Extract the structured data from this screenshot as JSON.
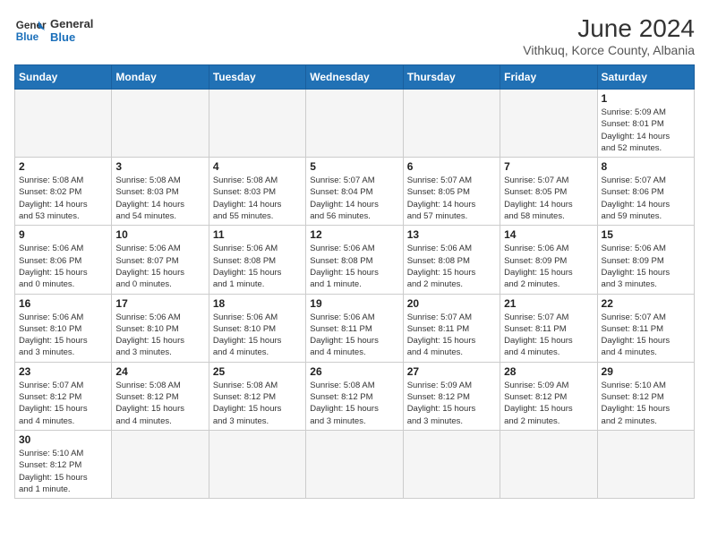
{
  "logo": {
    "general": "General",
    "blue": "Blue"
  },
  "title": "June 2024",
  "subtitle": "Vithkuq, Korce County, Albania",
  "days_of_week": [
    "Sunday",
    "Monday",
    "Tuesday",
    "Wednesday",
    "Thursday",
    "Friday",
    "Saturday"
  ],
  "weeks": [
    [
      {
        "day": "",
        "info": ""
      },
      {
        "day": "",
        "info": ""
      },
      {
        "day": "",
        "info": ""
      },
      {
        "day": "",
        "info": ""
      },
      {
        "day": "",
        "info": ""
      },
      {
        "day": "",
        "info": ""
      },
      {
        "day": "1",
        "info": "Sunrise: 5:09 AM\nSunset: 8:01 PM\nDaylight: 14 hours\nand 52 minutes."
      }
    ],
    [
      {
        "day": "2",
        "info": "Sunrise: 5:08 AM\nSunset: 8:02 PM\nDaylight: 14 hours\nand 53 minutes."
      },
      {
        "day": "3",
        "info": "Sunrise: 5:08 AM\nSunset: 8:03 PM\nDaylight: 14 hours\nand 54 minutes."
      },
      {
        "day": "4",
        "info": "Sunrise: 5:08 AM\nSunset: 8:03 PM\nDaylight: 14 hours\nand 55 minutes."
      },
      {
        "day": "5",
        "info": "Sunrise: 5:07 AM\nSunset: 8:04 PM\nDaylight: 14 hours\nand 56 minutes."
      },
      {
        "day": "6",
        "info": "Sunrise: 5:07 AM\nSunset: 8:05 PM\nDaylight: 14 hours\nand 57 minutes."
      },
      {
        "day": "7",
        "info": "Sunrise: 5:07 AM\nSunset: 8:05 PM\nDaylight: 14 hours\nand 58 minutes."
      },
      {
        "day": "8",
        "info": "Sunrise: 5:07 AM\nSunset: 8:06 PM\nDaylight: 14 hours\nand 59 minutes."
      }
    ],
    [
      {
        "day": "9",
        "info": "Sunrise: 5:06 AM\nSunset: 8:06 PM\nDaylight: 15 hours\nand 0 minutes."
      },
      {
        "day": "10",
        "info": "Sunrise: 5:06 AM\nSunset: 8:07 PM\nDaylight: 15 hours\nand 0 minutes."
      },
      {
        "day": "11",
        "info": "Sunrise: 5:06 AM\nSunset: 8:08 PM\nDaylight: 15 hours\nand 1 minute."
      },
      {
        "day": "12",
        "info": "Sunrise: 5:06 AM\nSunset: 8:08 PM\nDaylight: 15 hours\nand 1 minute."
      },
      {
        "day": "13",
        "info": "Sunrise: 5:06 AM\nSunset: 8:08 PM\nDaylight: 15 hours\nand 2 minutes."
      },
      {
        "day": "14",
        "info": "Sunrise: 5:06 AM\nSunset: 8:09 PM\nDaylight: 15 hours\nand 2 minutes."
      },
      {
        "day": "15",
        "info": "Sunrise: 5:06 AM\nSunset: 8:09 PM\nDaylight: 15 hours\nand 3 minutes."
      }
    ],
    [
      {
        "day": "16",
        "info": "Sunrise: 5:06 AM\nSunset: 8:10 PM\nDaylight: 15 hours\nand 3 minutes."
      },
      {
        "day": "17",
        "info": "Sunrise: 5:06 AM\nSunset: 8:10 PM\nDaylight: 15 hours\nand 3 minutes."
      },
      {
        "day": "18",
        "info": "Sunrise: 5:06 AM\nSunset: 8:10 PM\nDaylight: 15 hours\nand 4 minutes."
      },
      {
        "day": "19",
        "info": "Sunrise: 5:06 AM\nSunset: 8:11 PM\nDaylight: 15 hours\nand 4 minutes."
      },
      {
        "day": "20",
        "info": "Sunrise: 5:07 AM\nSunset: 8:11 PM\nDaylight: 15 hours\nand 4 minutes."
      },
      {
        "day": "21",
        "info": "Sunrise: 5:07 AM\nSunset: 8:11 PM\nDaylight: 15 hours\nand 4 minutes."
      },
      {
        "day": "22",
        "info": "Sunrise: 5:07 AM\nSunset: 8:11 PM\nDaylight: 15 hours\nand 4 minutes."
      }
    ],
    [
      {
        "day": "23",
        "info": "Sunrise: 5:07 AM\nSunset: 8:12 PM\nDaylight: 15 hours\nand 4 minutes."
      },
      {
        "day": "24",
        "info": "Sunrise: 5:08 AM\nSunset: 8:12 PM\nDaylight: 15 hours\nand 4 minutes."
      },
      {
        "day": "25",
        "info": "Sunrise: 5:08 AM\nSunset: 8:12 PM\nDaylight: 15 hours\nand 3 minutes."
      },
      {
        "day": "26",
        "info": "Sunrise: 5:08 AM\nSunset: 8:12 PM\nDaylight: 15 hours\nand 3 minutes."
      },
      {
        "day": "27",
        "info": "Sunrise: 5:09 AM\nSunset: 8:12 PM\nDaylight: 15 hours\nand 3 minutes."
      },
      {
        "day": "28",
        "info": "Sunrise: 5:09 AM\nSunset: 8:12 PM\nDaylight: 15 hours\nand 2 minutes."
      },
      {
        "day": "29",
        "info": "Sunrise: 5:10 AM\nSunset: 8:12 PM\nDaylight: 15 hours\nand 2 minutes."
      }
    ],
    [
      {
        "day": "30",
        "info": "Sunrise: 5:10 AM\nSunset: 8:12 PM\nDaylight: 15 hours\nand 1 minute."
      },
      {
        "day": "",
        "info": ""
      },
      {
        "day": "",
        "info": ""
      },
      {
        "day": "",
        "info": ""
      },
      {
        "day": "",
        "info": ""
      },
      {
        "day": "",
        "info": ""
      },
      {
        "day": "",
        "info": ""
      }
    ]
  ]
}
